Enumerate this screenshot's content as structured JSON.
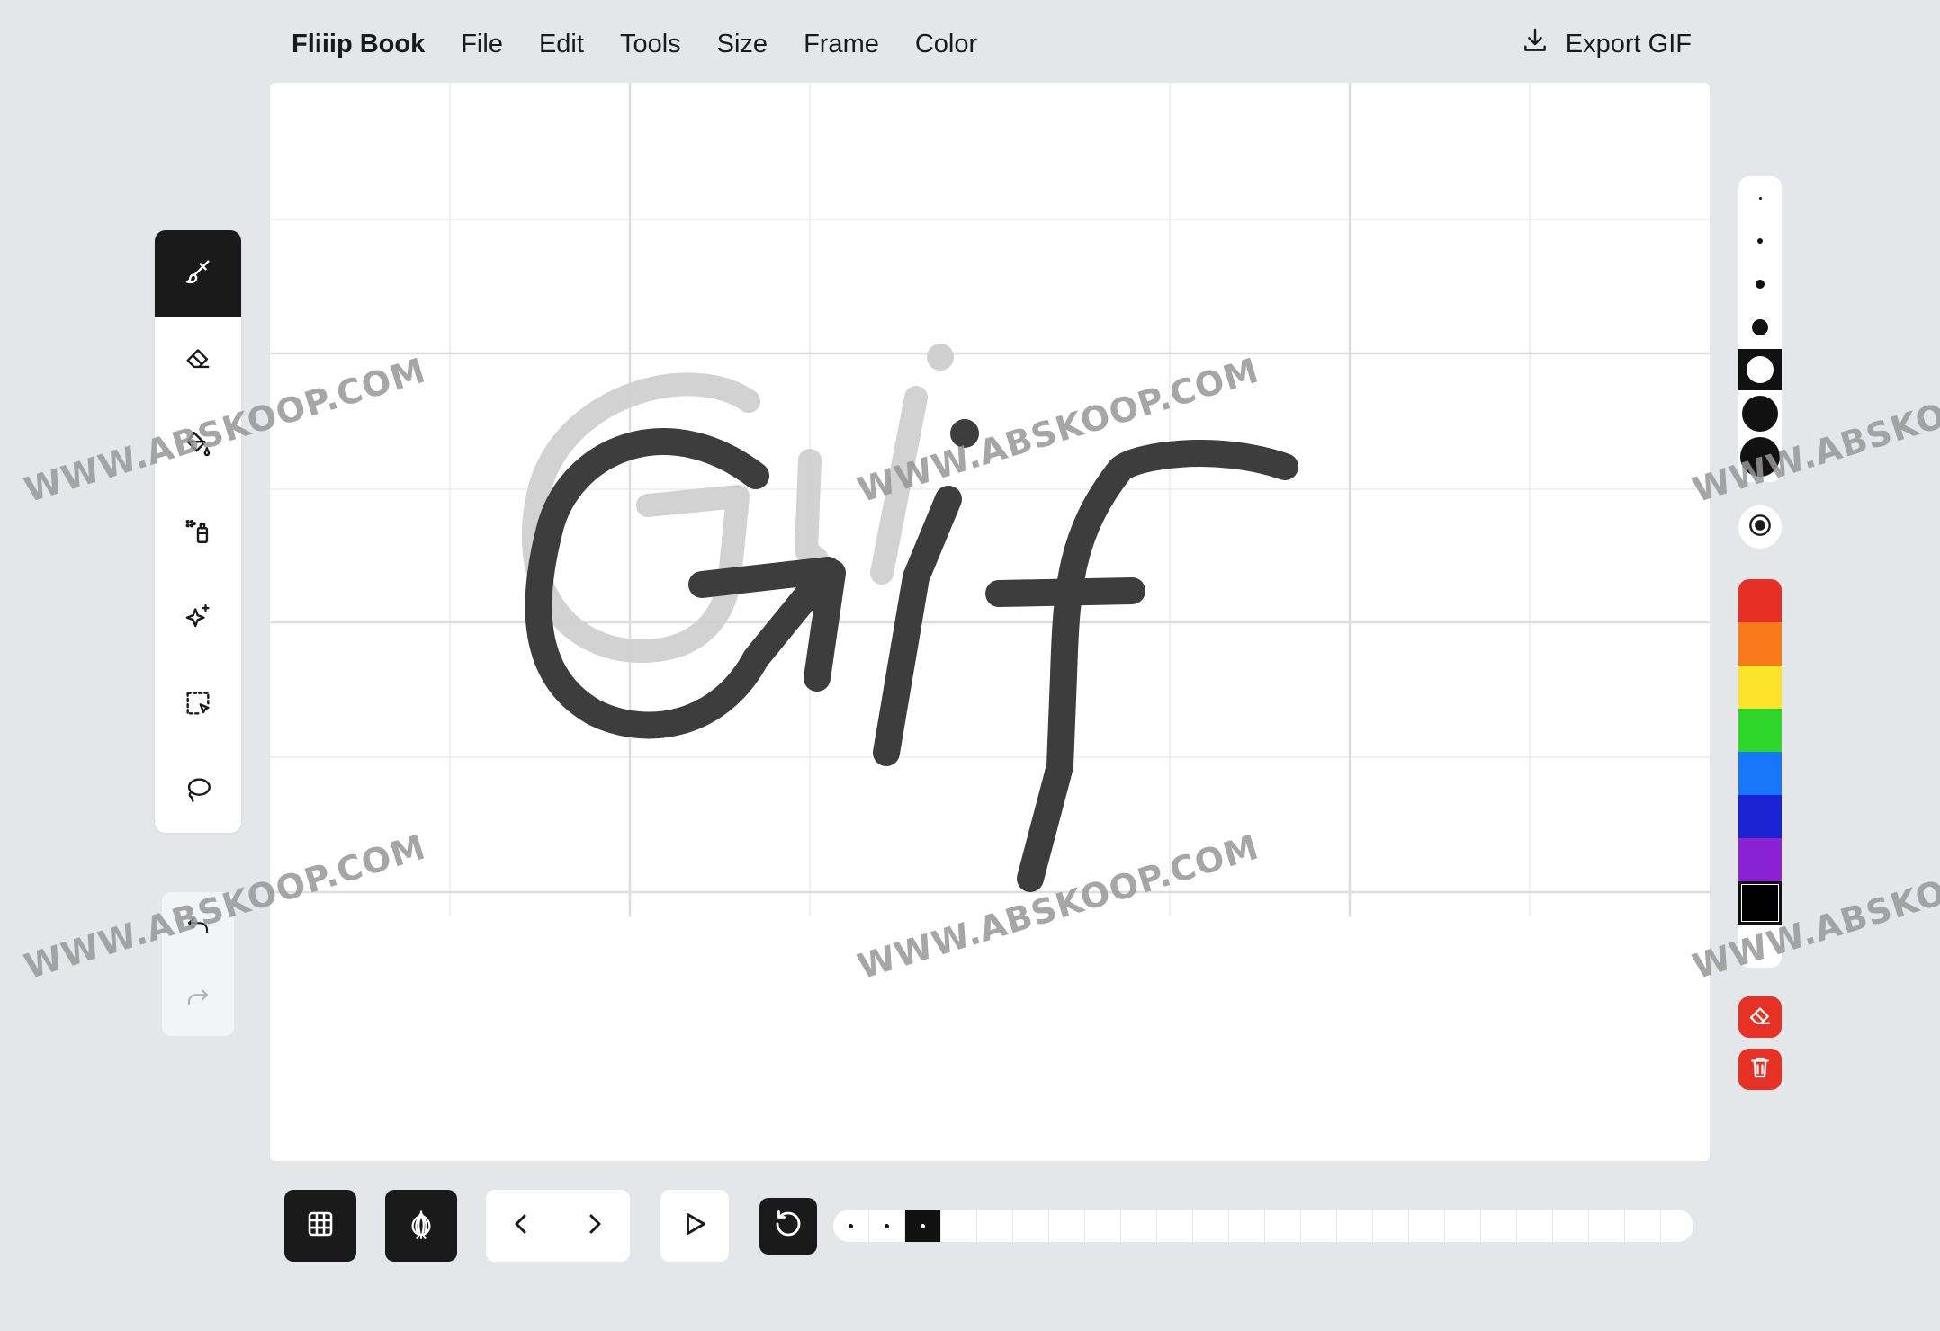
{
  "menubar": {
    "app_title": "Fliiip Book",
    "items": [
      "File",
      "Edit",
      "Tools",
      "Size",
      "Frame",
      "Color"
    ],
    "export_label": "Export GIF",
    "export_icon": "download-icon"
  },
  "toolbar": {
    "tools": [
      {
        "name": "brush",
        "icon": "brush-icon",
        "active": true
      },
      {
        "name": "eraser",
        "icon": "eraser-icon",
        "active": false
      },
      {
        "name": "fill",
        "icon": "paint-bucket-icon",
        "active": false
      },
      {
        "name": "spray",
        "icon": "spray-can-icon",
        "active": false
      },
      {
        "name": "sparkle",
        "icon": "sparkle-icon",
        "active": false
      },
      {
        "name": "select",
        "icon": "selection-icon",
        "active": false
      },
      {
        "name": "lasso",
        "icon": "lasso-icon",
        "active": false
      }
    ],
    "history": [
      "undo-icon",
      "redo-icon"
    ]
  },
  "brush_sizes": {
    "count": 7,
    "selected_index": 4
  },
  "colors": {
    "swatches": [
      "#e63025",
      "#f97a1b",
      "#fbe42b",
      "#2ed72a",
      "#1677fb",
      "#1c23d3",
      "#8a22d3",
      "#000000"
    ],
    "selected_index": 7
  },
  "actions": [
    "clear-frame-eraser-icon",
    "trash-icon"
  ],
  "canvas": {
    "ink_color": "#3d3d3d",
    "onion_color": "#cccccc"
  },
  "bottombar": {
    "icons": [
      "grid-icon",
      "onion-skin-icon",
      "chevron-left-icon",
      "chevron-right-icon",
      "play-icon",
      "loop-icon"
    ],
    "frames": {
      "total": 24,
      "filled": [
        0,
        1,
        2
      ],
      "current": 2
    }
  },
  "watermark": "WWW.ABSKOOP.COM"
}
